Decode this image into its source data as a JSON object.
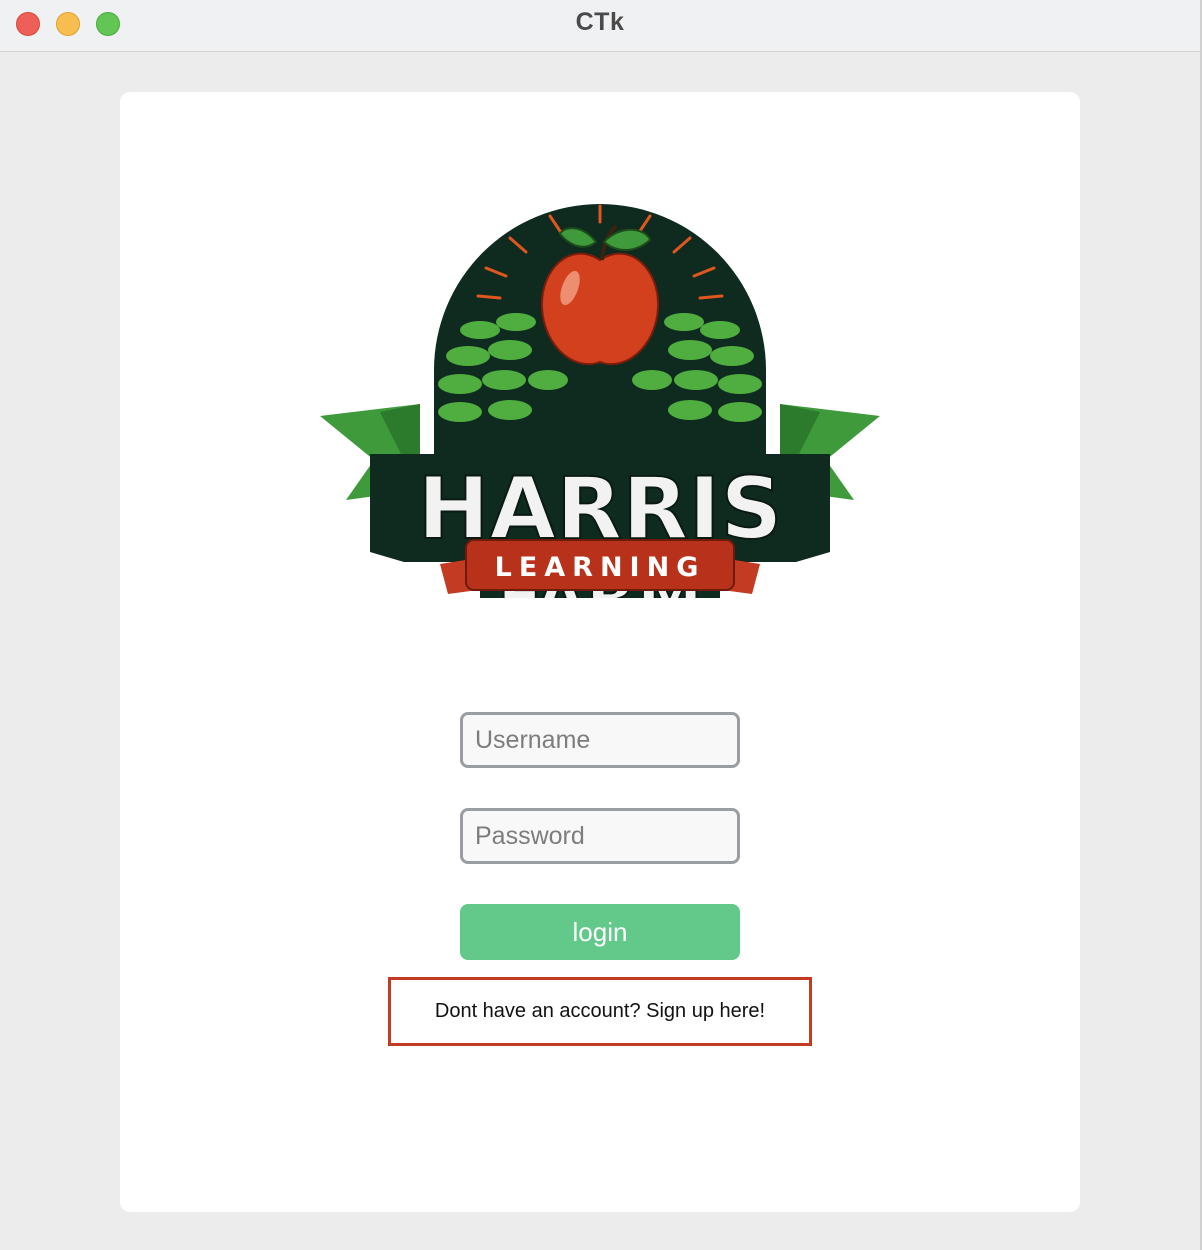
{
  "window": {
    "title": "CTk",
    "controls": [
      "close",
      "minimize",
      "zoom"
    ]
  },
  "logo": {
    "line1": "HARRIS",
    "line2": "FARM",
    "line3": "LEARNING",
    "icon": "apple-logo-icon"
  },
  "form": {
    "username_placeholder": "Username",
    "password_placeholder": "Password",
    "login_label": "login",
    "signup_label": "Dont have an account? Sign up here!"
  },
  "colors": {
    "login_button": "#63c98b",
    "signup_outline": "#c23b22",
    "logo_dark_green": "#0f2a1f",
    "logo_red": "#b8321b",
    "logo_leaf_green": "#3e9a3a"
  }
}
